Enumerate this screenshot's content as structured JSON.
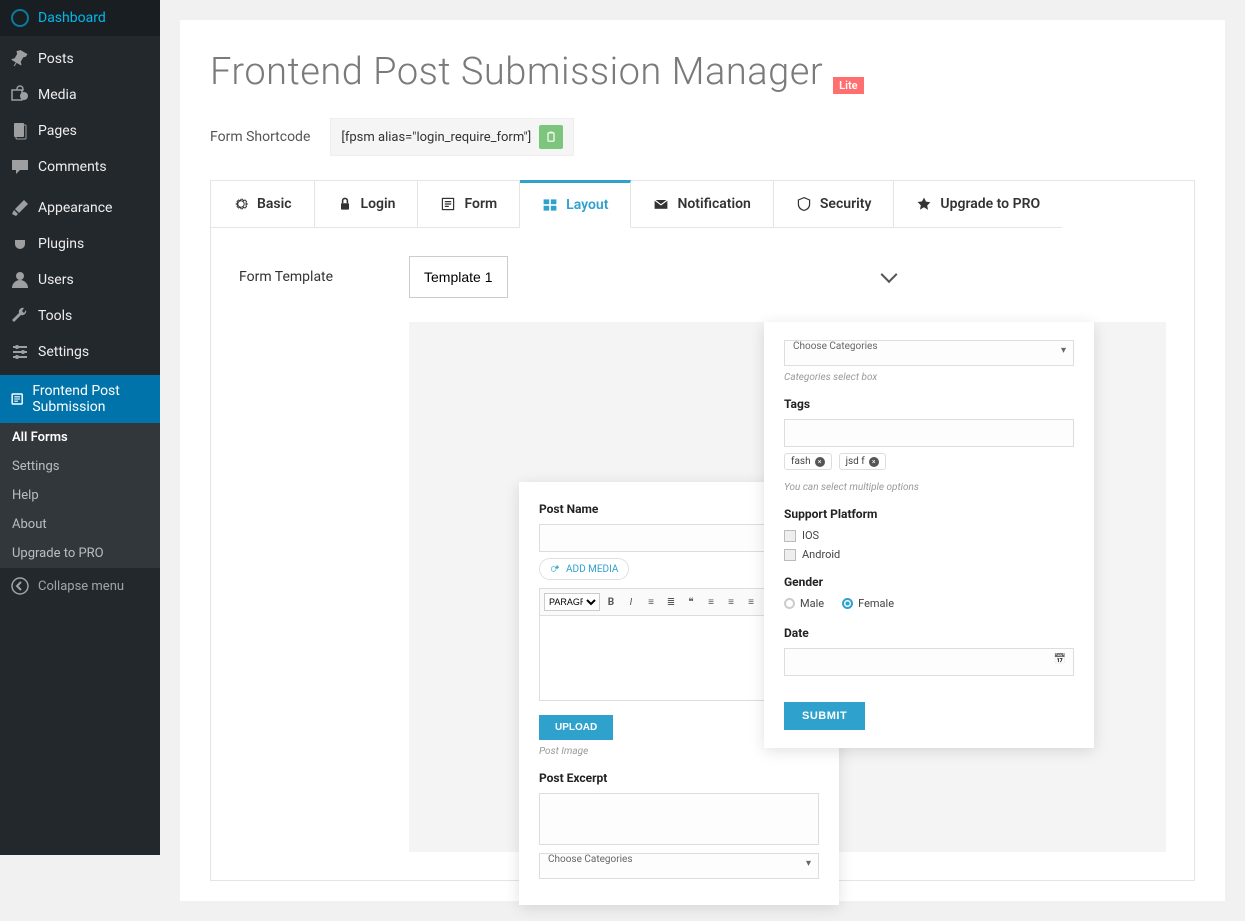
{
  "sidebar": {
    "items": [
      {
        "id": "dashboard",
        "label": "Dashboard"
      },
      {
        "id": "posts",
        "label": "Posts"
      },
      {
        "id": "media",
        "label": "Media"
      },
      {
        "id": "pages",
        "label": "Pages"
      },
      {
        "id": "comments",
        "label": "Comments"
      },
      {
        "id": "appearance",
        "label": "Appearance"
      },
      {
        "id": "plugins",
        "label": "Plugins"
      },
      {
        "id": "users",
        "label": "Users"
      },
      {
        "id": "tools",
        "label": "Tools"
      },
      {
        "id": "settings",
        "label": "Settings"
      },
      {
        "id": "fps",
        "label": "Frontend Post Submission"
      }
    ],
    "submenu": [
      {
        "label": "All Forms",
        "active": true
      },
      {
        "label": "Settings"
      },
      {
        "label": "Help"
      },
      {
        "label": "About"
      },
      {
        "label": "Upgrade to PRO"
      }
    ],
    "collapse": "Collapse menu"
  },
  "page": {
    "title": "Frontend Post Submission Manager",
    "badge": "Lite",
    "shortcode_label": "Form Shortcode",
    "shortcode_value": "[fpsm alias=\"login_require_form\"]"
  },
  "tabs": [
    {
      "id": "basic",
      "label": "Basic"
    },
    {
      "id": "login",
      "label": "Login"
    },
    {
      "id": "form",
      "label": "Form"
    },
    {
      "id": "layout",
      "label": "Layout",
      "active": true
    },
    {
      "id": "notification",
      "label": "Notification"
    },
    {
      "id": "security",
      "label": "Security"
    },
    {
      "id": "upgrade",
      "label": "Upgrade to PRO"
    }
  ],
  "layout": {
    "field_label": "Form Template",
    "template_value": "Template 1"
  },
  "preview": {
    "back": {
      "post_name_label": "Post Name",
      "add_media": "ADD MEDIA",
      "paragraph": "PARAGRA...",
      "upload": "UPLOAD",
      "post_image_hint": "Post Image",
      "post_excerpt_label": "Post Excerpt",
      "choose_categories": "Choose Categories"
    },
    "front": {
      "choose_categories": "Choose Categories",
      "categories_hint": "Categories select box",
      "tags_label": "Tags",
      "tag1": "fash",
      "tag2": "jsd f",
      "tags_hint": "You can select multiple options",
      "support_label": "Support Platform",
      "opt_ios": "IOS",
      "opt_android": "Android",
      "gender_label": "Gender",
      "gender_male": "Male",
      "gender_female": "Female",
      "date_label": "Date",
      "submit": "SUBMIT"
    }
  }
}
